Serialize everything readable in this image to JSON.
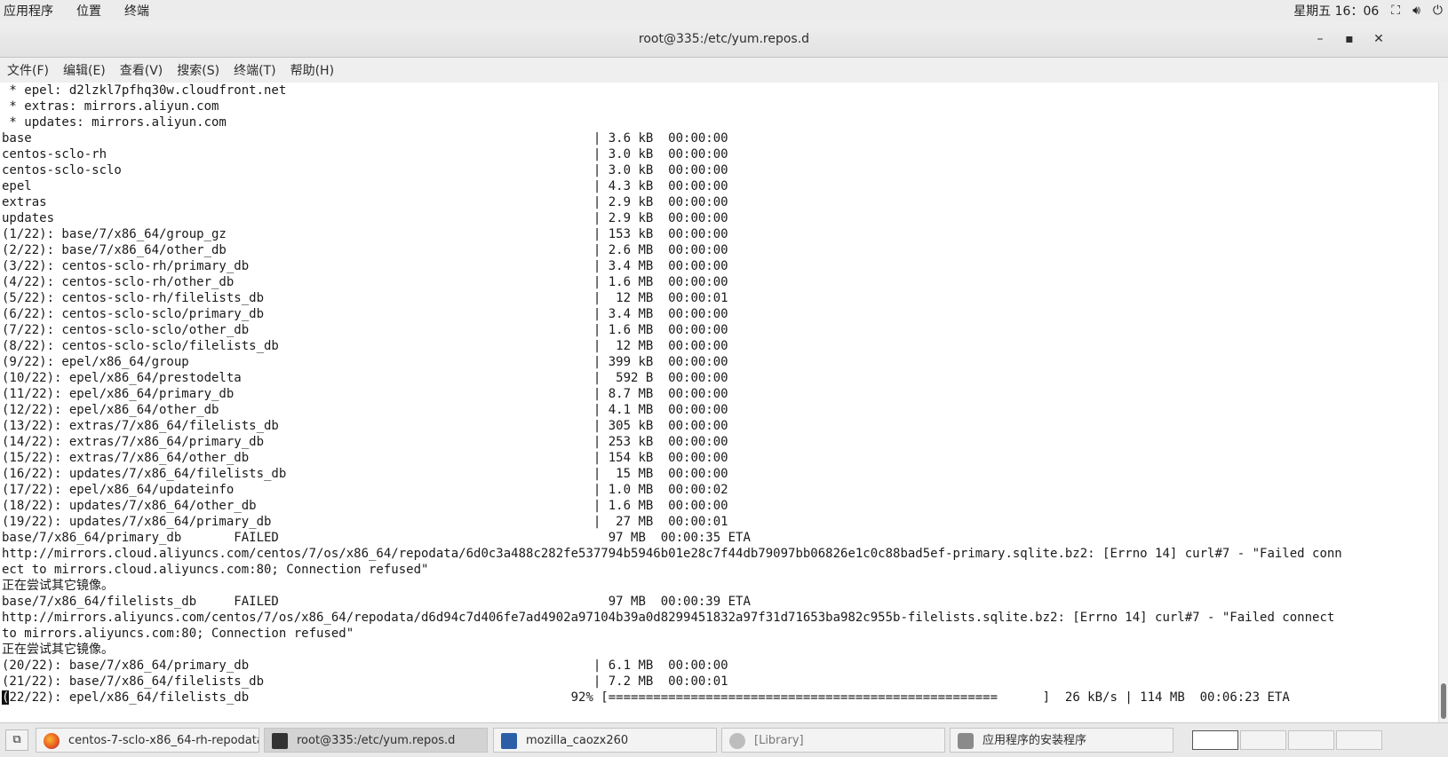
{
  "topbar": {
    "apps": "应用程序",
    "places": "位置",
    "terminal": "终端",
    "clock": "星期五 16：06",
    "network_icon": "network-icon",
    "volume_icon": "volume-icon",
    "power_icon": "power-icon"
  },
  "window": {
    "title": "root@335:/etc/yum.repos.d",
    "minimize": "–",
    "maximize": "▪",
    "close": "✕"
  },
  "menu": [
    "文件(F)",
    "编辑(E)",
    "查看(V)",
    "搜索(S)",
    "终端(T)",
    "帮助(H)"
  ],
  "terminal_lines": [
    " * epel: d2lzkl7pfhq30w.cloudfront.net",
    " * extras: mirrors.aliyun.com",
    " * updates: mirrors.aliyun.com",
    "base                                                                           | 3.6 kB  00:00:00",
    "centos-sclo-rh                                                                 | 3.0 kB  00:00:00",
    "centos-sclo-sclo                                                               | 3.0 kB  00:00:00",
    "epel                                                                           | 4.3 kB  00:00:00",
    "extras                                                                         | 2.9 kB  00:00:00",
    "updates                                                                        | 2.9 kB  00:00:00",
    "(1/22): base/7/x86_64/group_gz                                                 | 153 kB  00:00:00",
    "(2/22): base/7/x86_64/other_db                                                 | 2.6 MB  00:00:00",
    "(3/22): centos-sclo-rh/primary_db                                              | 3.4 MB  00:00:00",
    "(4/22): centos-sclo-rh/other_db                                                | 1.6 MB  00:00:00",
    "(5/22): centos-sclo-rh/filelists_db                                            |  12 MB  00:00:01",
    "(6/22): centos-sclo-sclo/primary_db                                            | 3.4 MB  00:00:00",
    "(7/22): centos-sclo-sclo/other_db                                              | 1.6 MB  00:00:00",
    "(8/22): centos-sclo-sclo/filelists_db                                          |  12 MB  00:00:00",
    "(9/22): epel/x86_64/group                                                      | 399 kB  00:00:00",
    "(10/22): epel/x86_64/prestodelta                                               |  592 B  00:00:00",
    "(11/22): epel/x86_64/primary_db                                                | 8.7 MB  00:00:00",
    "(12/22): epel/x86_64/other_db                                                  | 4.1 MB  00:00:00",
    "(13/22): extras/7/x86_64/filelists_db                                          | 305 kB  00:00:00",
    "(14/22): extras/7/x86_64/primary_db                                            | 253 kB  00:00:00",
    "(15/22): extras/7/x86_64/other_db                                              | 154 kB  00:00:00",
    "(16/22): updates/7/x86_64/filelists_db                                         |  15 MB  00:00:00",
    "(17/22): epel/x86_64/updateinfo                                                | 1.0 MB  00:00:02",
    "(18/22): updates/7/x86_64/other_db                                             | 1.6 MB  00:00:00",
    "(19/22): updates/7/x86_64/primary_db                                           |  27 MB  00:00:01",
    "base/7/x86_64/primary_db       FAILED                                            97 MB  00:00:35 ETA",
    "http://mirrors.cloud.aliyuncs.com/centos/7/os/x86_64/repodata/6d0c3a488c282fe537794b5946b01e28c7f44db79097bb06826e1c0c88bad5ef-primary.sqlite.bz2: [Errno 14] curl#7 - \"Failed conn",
    "ect to mirrors.cloud.aliyuncs.com:80; Connection refused\"",
    "正在尝试其它镜像。",
    "base/7/x86_64/filelists_db     FAILED                                            97 MB  00:00:39 ETA",
    "http://mirrors.aliyuncs.com/centos/7/os/x86_64/repodata/d6d94c7d406fe7ad4902a97104b39a0d8299451832a97f31d71653ba982c955b-filelists.sqlite.bz2: [Errno 14] curl#7 - \"Failed connect",
    "to mirrors.aliyuncs.com:80; Connection refused\"",
    "正在尝试其它镜像。",
    "(20/22): base/7/x86_64/primary_db                                              | 6.1 MB  00:00:00",
    "(21/22): base/7/x86_64/filelists_db                                            | 7.2 MB  00:00:01"
  ],
  "progress_line": {
    "cursor_char": "(",
    "text": "22/22): epel/x86_64/filelists_db                                           92% [",
    "bar": "====================================================",
    "tail": "      ]  26 kB/s | 114 MB  00:06:23 ETA"
  },
  "taskbar": {
    "items": [
      {
        "label": "centos-7-sclo-x86_64-rh-repodata...",
        "icon": "firefox-icon"
      },
      {
        "label": "root@335:/etc/yum.repos.d",
        "icon": "terminal-icon"
      },
      {
        "label": "mozilla_caozx260",
        "icon": "file-manager-icon"
      },
      {
        "label": "[Library]",
        "icon": "firefox-icon"
      },
      {
        "label": "应用程序的安装程序",
        "icon": "installer-icon"
      }
    ],
    "show_desktop_icon": "show-desktop-icon"
  }
}
